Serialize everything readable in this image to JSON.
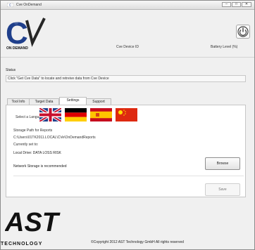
{
  "window": {
    "title": "Cve OnDemand",
    "buttons": {
      "minimize": "–",
      "maximize": "□",
      "close": "✕"
    }
  },
  "header": {
    "logo_text": "CV",
    "logo_tagline": "ON DEMAND",
    "cve_device_label": "Cve Device ID",
    "battery_label": "Battery Level (%)",
    "power_icon": "power-icon"
  },
  "status": {
    "title": "Status",
    "message": "Click \"Get Cve Data\" to locate and retreive data from Cve Device"
  },
  "tabs": [
    {
      "label": "Tool Info",
      "active": false
    },
    {
      "label": "Target Data",
      "active": false
    },
    {
      "label": "Settings",
      "active": true
    },
    {
      "label": "Support",
      "active": false
    }
  ],
  "settings": {
    "select_language_label": "Select a Language",
    "languages": [
      {
        "name": "English",
        "icon": "uk-flag-icon"
      },
      {
        "name": "German",
        "icon": "germany-flag-icon"
      },
      {
        "name": "Spanish",
        "icon": "spain-flag-icon"
      },
      {
        "name": "Chinese",
        "icon": "china-flag-icon"
      }
    ],
    "storage_label": "Storage Path for Reports",
    "storage_path": "C:\\Users\\01TK2011.LOCAL\\CVe\\OnDemandReports",
    "currently_set_label": "Currently set to:",
    "local_drive_text": "Local Drive: DATA LOSS RISK",
    "network_note": "Network Storage is recommended",
    "browse_label": "Browse",
    "save_label": "Save"
  },
  "footer": {
    "brand": "AST",
    "brand_tagline": "TECHNOLOGY",
    "copyright": "©Copyright 2012 AST Technology GmbH All rights reserved"
  },
  "colors": {
    "panel": "#ffffff",
    "window_bg": "#f0f0f0",
    "logo_blue": "#1f3f8b",
    "logo_gray": "#262626",
    "flag_red": "#c8102e",
    "flag_yellow": "#ffcc00"
  }
}
